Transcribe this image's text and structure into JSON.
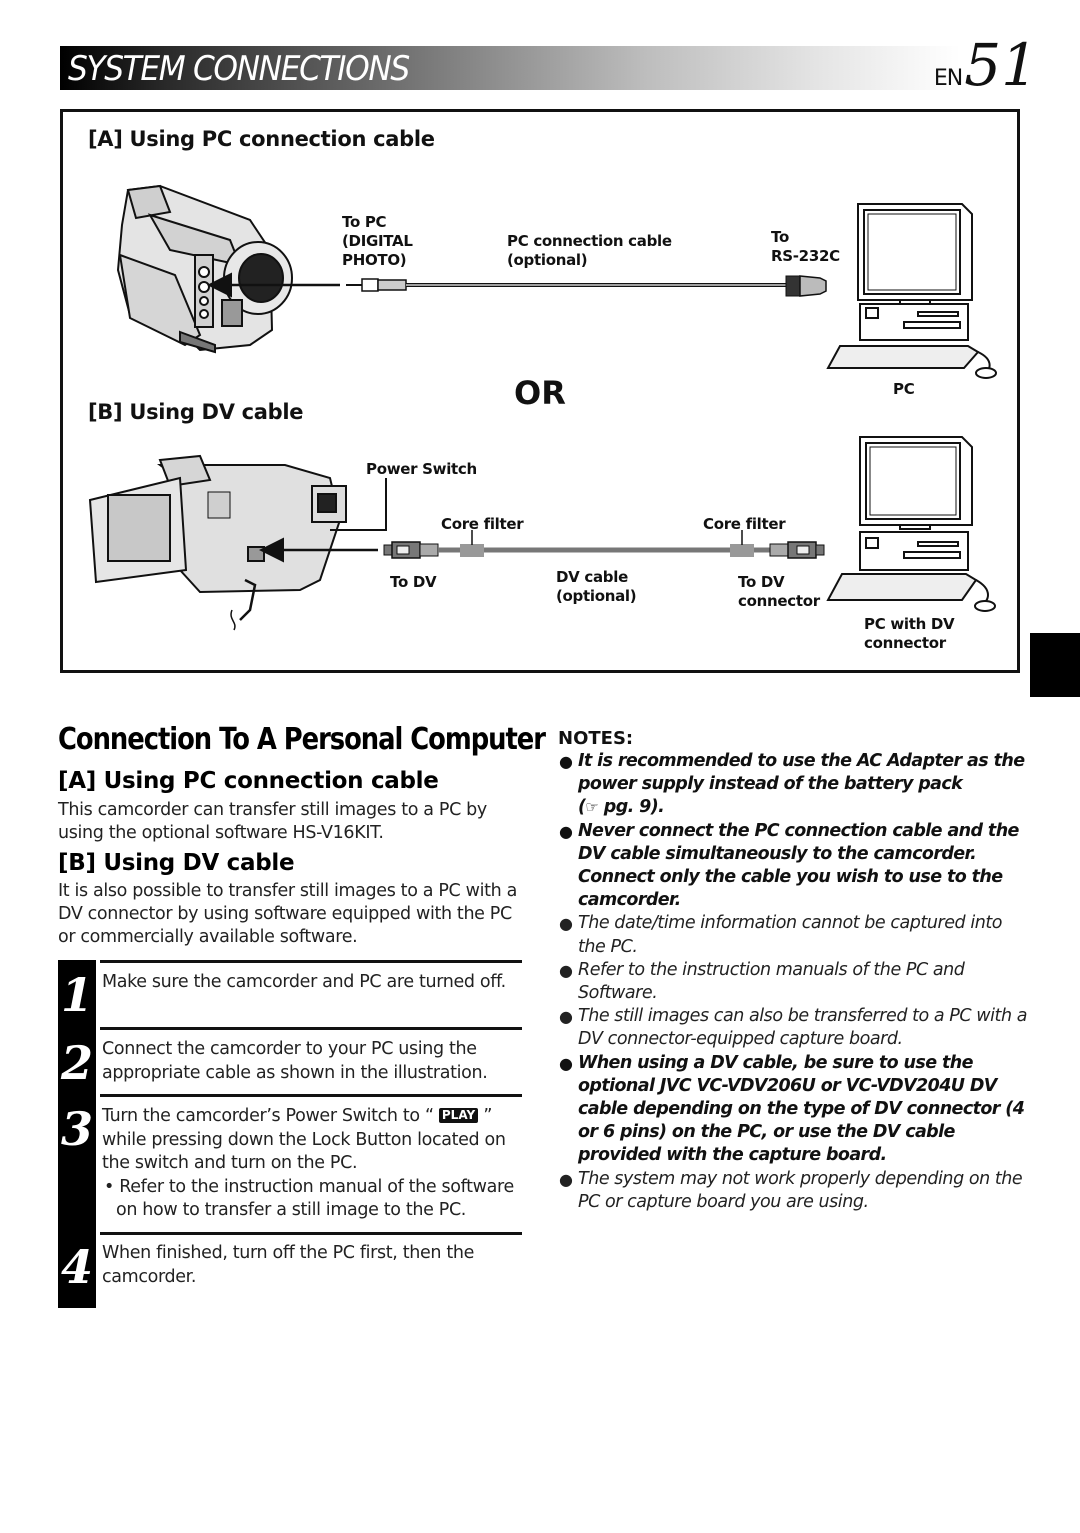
{
  "header": {
    "title": "SYSTEM CONNECTIONS",
    "page_prefix": "EN",
    "page_number": "51"
  },
  "diagram": {
    "section_a": {
      "heading": "[A] Using PC connection cable",
      "to_pc_label": [
        "To PC",
        "(DIGITAL",
        "PHOTO)"
      ],
      "cable_label": [
        "PC connection cable",
        "(optional)"
      ],
      "rs232_label": [
        "To",
        "RS-232C"
      ],
      "pc_label": "PC"
    },
    "or_label": "OR",
    "section_b": {
      "heading": "[B] Using DV cable",
      "power_switch_label": "Power Switch",
      "core_filter_left": "Core filter",
      "core_filter_right": "Core filter",
      "to_dv_label": "To DV",
      "dv_cable_label": [
        "DV cable",
        "(optional)"
      ],
      "to_dv_connector_label": [
        "To DV",
        "connector"
      ],
      "pc_with_dv_label": [
        "PC with DV",
        "connector"
      ]
    }
  },
  "main": {
    "title": "Connection To A Personal Computer",
    "section_a": {
      "heading": "[A] Using PC connection cable",
      "body": "This camcorder can transfer still images to a PC by using the optional software HS-V16KIT."
    },
    "section_b": {
      "heading": "[B] Using DV cable",
      "body": "It is also possible to transfer still images to a PC with a DV connector by using software equipped with the PC or commercially available software."
    },
    "steps": [
      {
        "number": "1",
        "text": "Make sure the camcorder and PC are turned off."
      },
      {
        "number": "2",
        "text": "Connect the camcorder to your PC using the appropriate cable as shown in the illustration."
      },
      {
        "number": "3",
        "text_before": "Turn the camcorder’s Power Switch to “ ",
        "badge": "PLAY",
        "text_after": " ” while pressing down the Lock Button located on the switch and turn on the PC.",
        "sub_bullet": "Refer to the instruction manual of the software on how to transfer a still image to the PC."
      },
      {
        "number": "4",
        "text": "When finished, turn off the PC first, then the camcorder."
      }
    ]
  },
  "notes": {
    "title": "NOTES:",
    "items": [
      {
        "text": "It is recommended to use the AC Adapter as the power supply instead of the battery pack",
        "ref": "pg. 9).",
        "ref_prefix": "(",
        "bold": true
      },
      {
        "text": "Never connect the PC connection cable and the DV cable simultaneously to the camcorder. Connect only the cable you wish to use to the camcorder.",
        "bold": true
      },
      {
        "text": "The date/time information cannot be captured into the PC.",
        "bold": false
      },
      {
        "text": "Refer to the instruction manuals of the PC and Software.",
        "bold": false
      },
      {
        "text": "The still images can also be transferred to a PC with a DV connector-equipped capture board.",
        "bold": false
      },
      {
        "text": "When using a DV cable, be sure to use the optional JVC VC-VDV206U or VC-VDV204U DV cable depending on the type of DV connector (4 or 6 pins) on the PC, or use the DV cable provided with the capture board.",
        "bold": true
      },
      {
        "text": "The system may not work properly depending on the PC or capture board you are using.",
        "bold": false
      }
    ]
  },
  "colors": {
    "ink": "#111111",
    "cable_gray": "#8a8a8a",
    "body_gray": "#d8d8d8"
  }
}
